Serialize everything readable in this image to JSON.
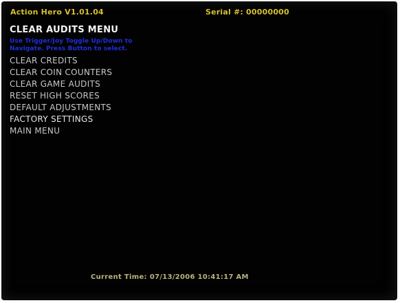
{
  "header": {
    "title": "Action Hero V1.01.04",
    "serial_label": "Serial #: 00000000"
  },
  "menu_title": "CLEAR AUDITS MENU",
  "hint": {
    "line1": "Use Trigger/Joy Toggle Up/Down to",
    "line2": "Navigate. Press Button to select."
  },
  "menu": {
    "items": [
      {
        "label": "CLEAR CREDITS"
      },
      {
        "label": "CLEAR COIN COUNTERS"
      },
      {
        "label": "CLEAR GAME AUDITS"
      },
      {
        "label": "RESET HIGH SCORES"
      },
      {
        "label": "DEFAULT ADJUSTMENTS"
      },
      {
        "label": "FACTORY SETTINGS"
      },
      {
        "label": "MAIN MENU"
      }
    ]
  },
  "footer": {
    "label": "Current Time:",
    "datetime": "07/13/2006 10:41:17 AM"
  },
  "colors": {
    "background": "#020202",
    "header_text": "#d7c02c",
    "hint_text": "#1e2fd9",
    "menu_text": "#c8c8c8",
    "title_text": "#f4f4f4",
    "footer_text": "#b8b47e"
  }
}
